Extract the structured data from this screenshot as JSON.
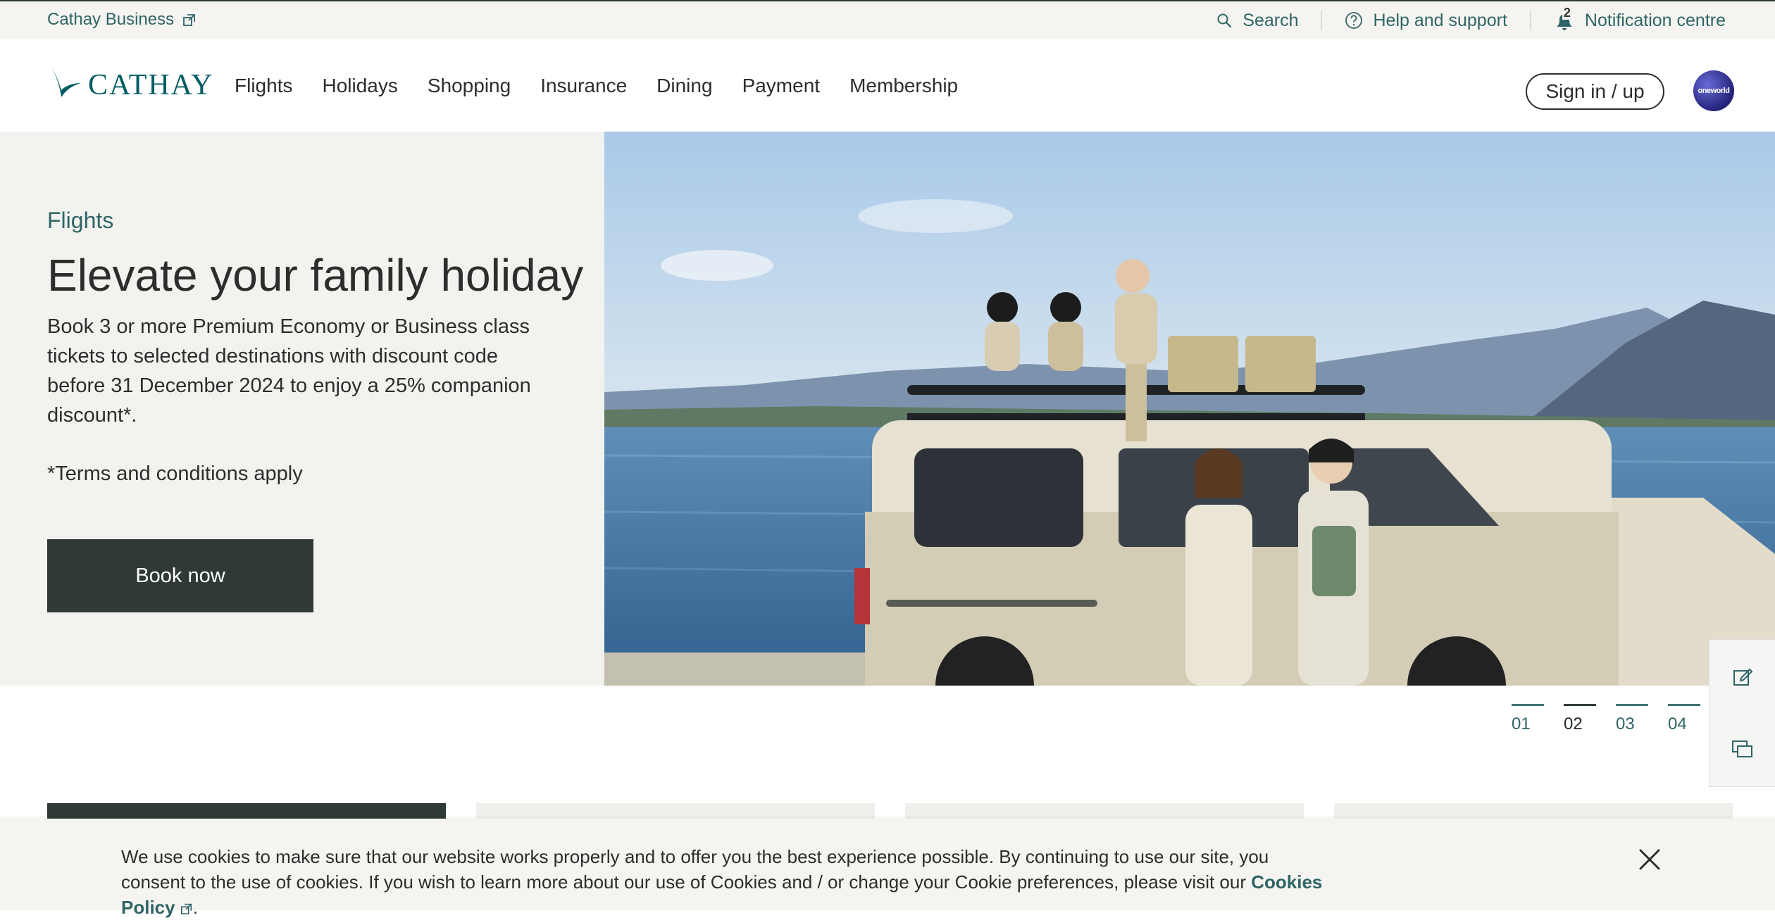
{
  "utility": {
    "business_link": "Cathay Business",
    "search": "Search",
    "help": "Help and support",
    "notifications": "Notification centre",
    "notification_count": "2"
  },
  "header": {
    "logo_text": "CATHAY",
    "nav": [
      "Flights",
      "Holidays",
      "Shopping",
      "Insurance",
      "Dining",
      "Payment",
      "Membership"
    ],
    "signin": "Sign in / up",
    "alliance_badge": "oneworld"
  },
  "hero": {
    "eyebrow": "Flights",
    "title": "Elevate your family holiday",
    "body": "Book 3 or more Premium Economy or Business class tickets to selected destinations with discount code before 31 December 2024 to enjoy a 25% companion discount*.",
    "terms": "*Terms and conditions apply",
    "cta": "Book now"
  },
  "carousel": {
    "slides": [
      "01",
      "02",
      "03",
      "04"
    ],
    "active_index": 1
  },
  "cookie": {
    "text": "We use cookies to make sure that our website works properly and to offer you the best experience possible. By continuing to use our site, you consent to the use of cookies. If you wish to learn more about our use of Cookies and / or change your Cookie preferences, please visit our ",
    "link": "Cookies Policy",
    "suffix": "."
  },
  "colors": {
    "accent_teal": "#2f6566",
    "dark_green": "#2f3a36",
    "panel_bg": "#f2f2ef"
  }
}
